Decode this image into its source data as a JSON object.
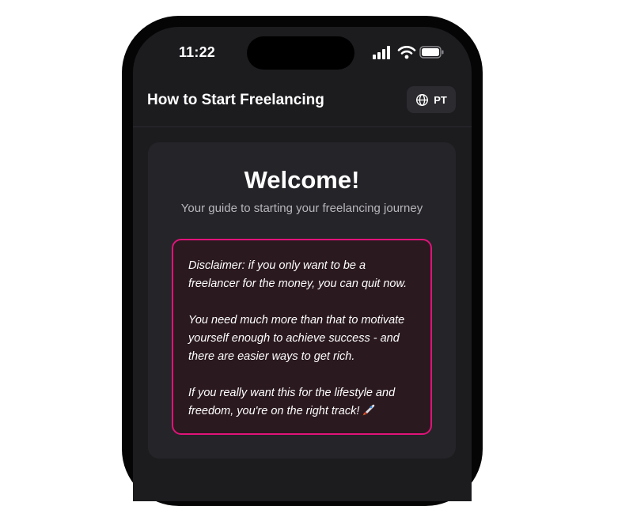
{
  "status_bar": {
    "time": "11:22",
    "icons": [
      "signal-icon",
      "wifi-icon",
      "battery-icon"
    ]
  },
  "header": {
    "title": "How to Start Freelancing",
    "lang_button": {
      "icon": "globe-icon",
      "label": "PT"
    }
  },
  "welcome": {
    "title": "Welcome!",
    "subtitle": "Your guide to starting your freelancing journey"
  },
  "disclaimer": {
    "paragraphs": [
      "Disclaimer: if you only want to be a freelancer for the money, you can quit now.",
      "You need much more than that to motivate yourself enough to achieve success - and there are easier ways to get rich.",
      "If you really want this for the lifestyle and freedom, you're on the right track!"
    ],
    "trailing_icon": "rocket-icon"
  },
  "colors": {
    "screen_bg": "#1c1b1e",
    "card_bg": "#252428",
    "disclaimer_border": "#e0137a",
    "disclaimer_bg": "#2a191f",
    "text_primary": "#ffffff",
    "text_secondary": "#b8b7bc"
  }
}
